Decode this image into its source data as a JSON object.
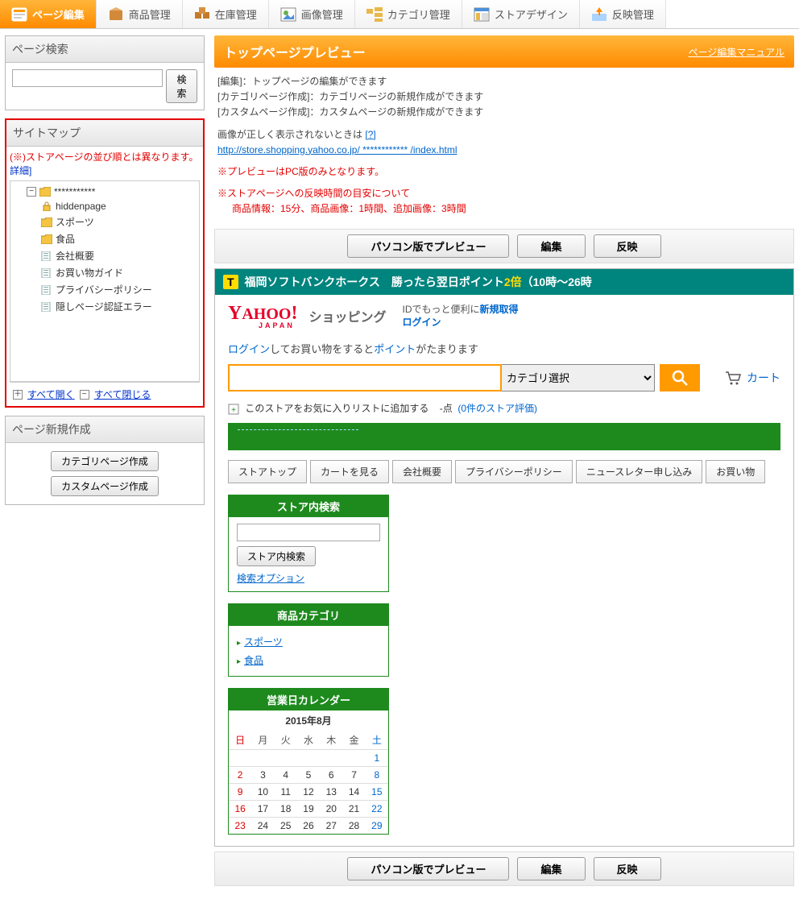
{
  "topnav": [
    {
      "label": "ページ編集",
      "active": true
    },
    {
      "label": "商品管理"
    },
    {
      "label": "在庫管理"
    },
    {
      "label": "画像管理"
    },
    {
      "label": "カテゴリ管理"
    },
    {
      "label": "ストアデザイン"
    },
    {
      "label": "反映管理"
    }
  ],
  "sidebar": {
    "search_panel_title": "ページ検索",
    "search_btn": "検索",
    "sitemap_title": "サイトマップ",
    "sitemap_note": "(※)ストアページの並び順とは異なります。",
    "sitemap_detail_link": "詳細]",
    "tree_root": "***********",
    "tree_items": [
      "hiddenpage",
      "スポーツ",
      "食品",
      "会社概要",
      "お買い物ガイド",
      "プライバシーポリシー",
      "隠しページ認証エラー"
    ],
    "expand_all": "すべて開く",
    "collapse_all": "すべて閉じる",
    "newpage_title": "ページ新規作成",
    "newpage_cat_btn": "カテゴリページ作成",
    "newpage_custom_btn": "カスタムページ作成"
  },
  "main": {
    "titlebar_title": "トップページプレビュー",
    "titlebar_manual": "ページ編集マニュアル",
    "desc_lines": [
      "[編集]：トップページの編集ができます",
      "[カテゴリページ作成]：カテゴリページの新規作成ができます",
      "[カスタムページ作成]：カスタムページの新規作成ができます"
    ],
    "image_warn": "画像が正しく表示されないときは",
    "qmark": "[?]",
    "url": "http://store.shopping.yahoo.co.jp/ ************   /index.html",
    "pc_only": "※プレビューはPC版のみとなります。",
    "reflect_note_l1": "※ストアページへの反映時間の目安について",
    "reflect_note_l2": "商品情報：15分、商品画像：1時間、追加画像：3時間",
    "btns": {
      "preview": "パソコン版でプレビュー",
      "edit": "編集",
      "reflect": "反映"
    }
  },
  "preview": {
    "banner_prefix": "福岡ソフトバンクホークス　勝ったら翌日ポイント",
    "banner_bold": "2倍",
    "banner_suffix": "（10時～26時",
    "shopping_label": "ショッピング",
    "id_line": "IDでもっと便利に",
    "id_newreg": "新規取得",
    "id_login": "ログイン",
    "login_pre": "ログイン",
    "login_mid": "してお買い物をすると",
    "login_point": "ポイント",
    "login_post": "がたまります",
    "category_select": "カテゴリ選択",
    "cart_label": "カート",
    "fav_add": "このストアをお気に入りリストに追加する",
    "fav_count": "-点",
    "fav_reviews": "(0件のストア評価)",
    "tabs": [
      "ストアトップ",
      "カートを見る",
      "会社概要",
      "プライバシーポリシー",
      "ニュースレター申し込み",
      "お買い物"
    ],
    "widget_search": {
      "title": "ストア内検索",
      "btn": "ストア内検索",
      "opt": "検索オプション"
    },
    "widget_cat": {
      "title": "商品カテゴリ",
      "items": [
        "スポーツ",
        "食品"
      ]
    },
    "calendar": {
      "title": "営業日カレンダー",
      "caption": "2015年8月",
      "dow": [
        "日",
        "月",
        "火",
        "水",
        "木",
        "金",
        "土"
      ],
      "weeks": [
        [
          "",
          "",
          "",
          "",
          "",
          "",
          "1"
        ],
        [
          "2",
          "3",
          "4",
          "5",
          "6",
          "7",
          "8"
        ],
        [
          "9",
          "10",
          "11",
          "12",
          "13",
          "14",
          "15"
        ],
        [
          "16",
          "17",
          "18",
          "19",
          "20",
          "21",
          "22"
        ],
        [
          "23",
          "24",
          "25",
          "26",
          "27",
          "28",
          "29"
        ]
      ]
    }
  }
}
